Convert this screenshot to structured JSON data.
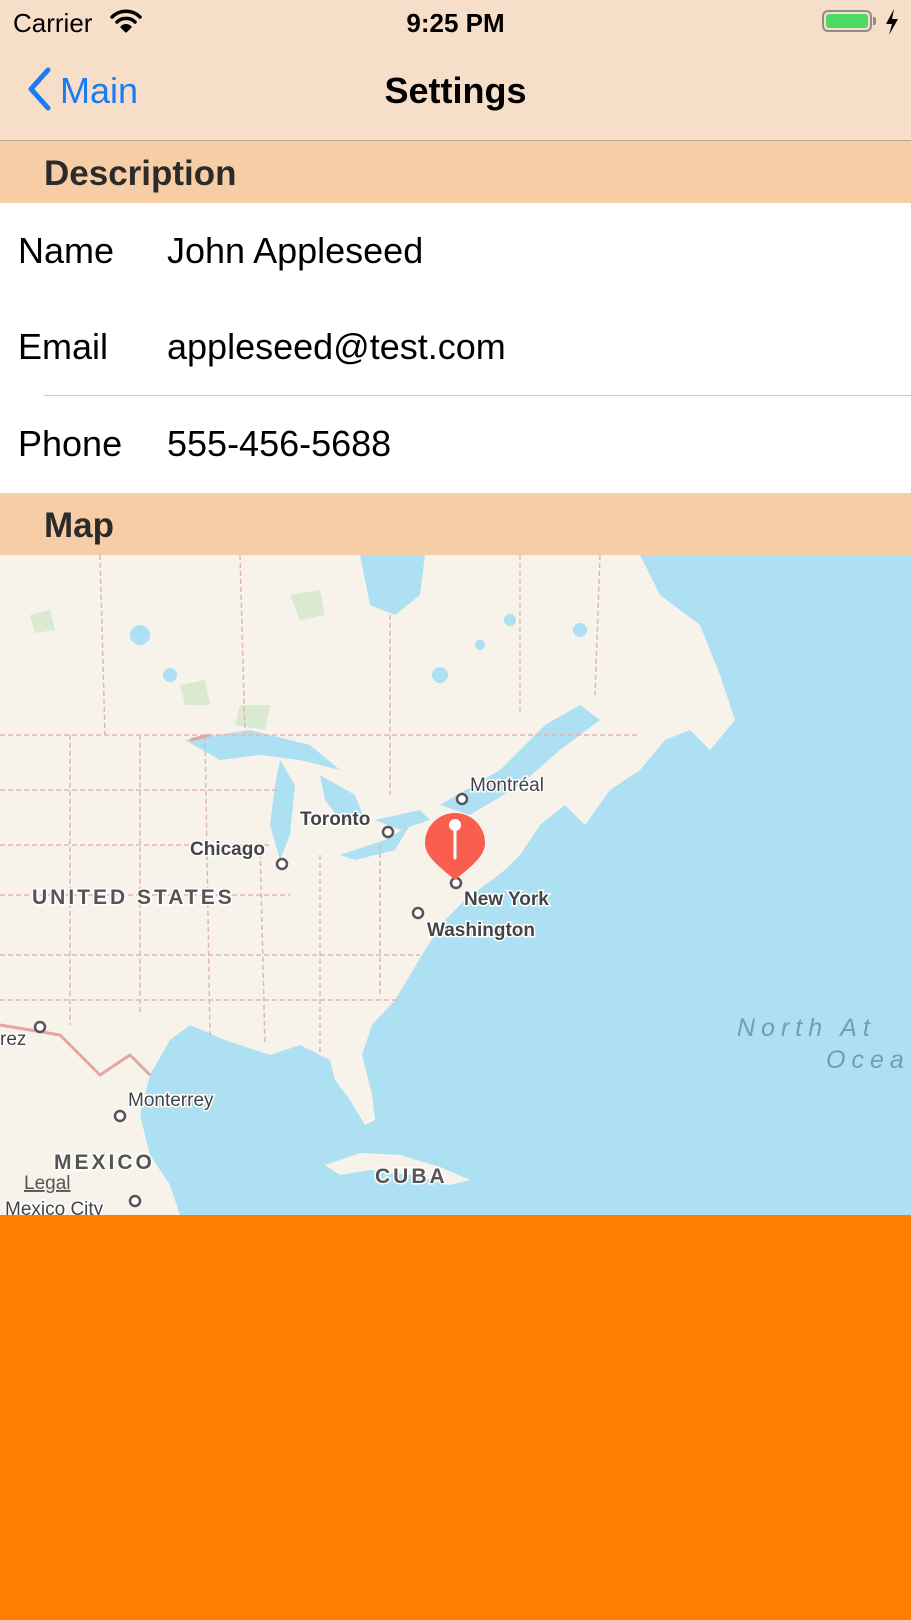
{
  "status_bar": {
    "carrier": "Carrier",
    "time": "9:25 PM",
    "battery_level": 1.0
  },
  "nav": {
    "back_label": "Main",
    "title": "Settings"
  },
  "sections": {
    "description": "Description",
    "map": "Map"
  },
  "fields": [
    {
      "label": "Name",
      "value": "John Appleseed"
    },
    {
      "label": "Email",
      "value": "appleseed@test.com"
    },
    {
      "label": "Phone",
      "value": "555-456-5688"
    }
  ],
  "map_labels": {
    "montreal": "Montréal",
    "toronto": "Toronto",
    "chicago": "Chicago",
    "united_states": "UNITED STATES",
    "new_york": "New York",
    "washington": "Washington",
    "north_atlantic_line1": "North At",
    "north_atlantic_line2": "Ocea",
    "juarez_fragment": "rez",
    "monterrey": "Monterrey",
    "mexico": "MEXICO",
    "cuba": "CUBA",
    "legal": "Legal",
    "mexico_city": "Mexico City"
  },
  "colors": {
    "bar_background": "#f6dec8",
    "section_header": "#f7cda5",
    "accent": "#1a7cf5",
    "bottom_panel": "#ff7f00",
    "pin": "#f95e4f",
    "water": "#aee0f4",
    "land": "#f7f3ea"
  }
}
